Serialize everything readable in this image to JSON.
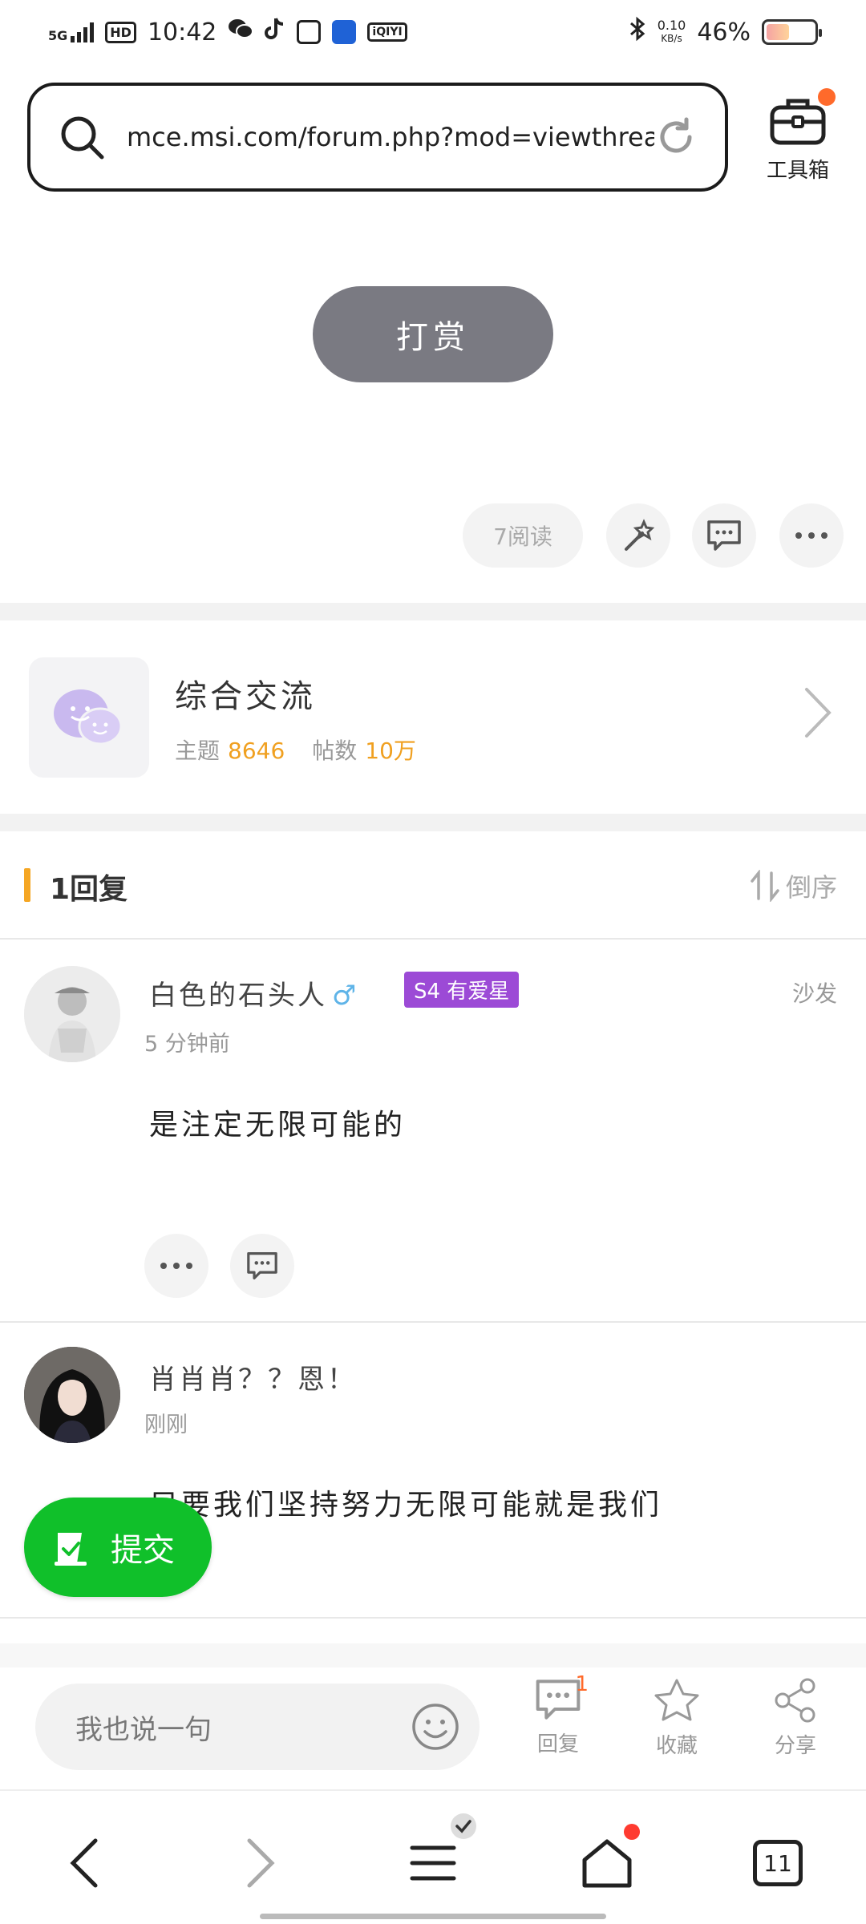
{
  "status": {
    "network": "5G",
    "hd": "HD",
    "time": "10:42",
    "speed_value": "0.10",
    "speed_unit": "KB/s",
    "battery": "46%",
    "icons": [
      "wechat-icon",
      "tiktok-icon",
      "app-icon",
      "browser-app-icon",
      "iqiyi-icon",
      "bluetooth-icon"
    ]
  },
  "addressbar": {
    "url": "mce.msi.com/forum.php?mod=viewthrea…",
    "toolbox_label": "工具箱"
  },
  "post": {
    "reward_label": "打赏",
    "read_count": "7阅读"
  },
  "forum": {
    "name": "综合交流",
    "topics_label": "主题",
    "topics_value": "8646",
    "posts_label": "帖数",
    "posts_value": "10万"
  },
  "replies": {
    "title": "1回复",
    "sort_label": "倒序"
  },
  "comments": [
    {
      "name": "白色的石头人",
      "gender_icon": "♂",
      "badge": "S4 有爱星",
      "floor": "沙发",
      "time": "5 分钟前",
      "text": "是注定无限可能的"
    },
    {
      "name": "肖肖肖？？恩！",
      "time": "刚刚",
      "text": "只要我们坚持努力无限可能就是我们"
    }
  ],
  "submit": {
    "label": "提交"
  },
  "bottombar": {
    "placeholder": "我也说一句",
    "reply_label": "回复",
    "reply_count": "1",
    "favorite_label": "收藏",
    "share_label": "分享"
  },
  "nav": {
    "tabs_count": "11"
  },
  "colors": {
    "accent_orange": "#f5a623",
    "badge_purple": "#9c4ad6",
    "submit_green": "#10c02a",
    "notify_red": "#ff3b30"
  }
}
